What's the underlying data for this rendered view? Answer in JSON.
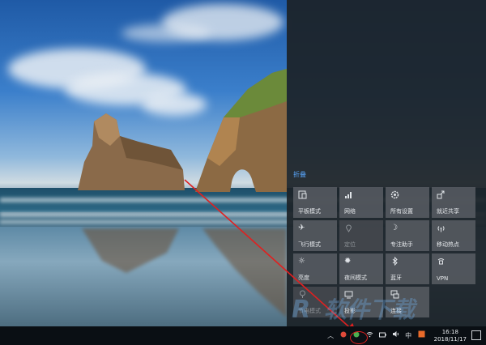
{
  "action_center": {
    "collapse_label": "折叠",
    "tiles": [
      {
        "label": "平板模式",
        "icon": "tablet-mode-icon",
        "state": "on"
      },
      {
        "label": "网络",
        "icon": "network-icon",
        "state": "on"
      },
      {
        "label": "所有设置",
        "icon": "settings-icon",
        "state": "on"
      },
      {
        "label": "就近共享",
        "icon": "nearby-share-icon",
        "state": "on"
      },
      {
        "label": "飞行模式",
        "icon": "airplane-icon",
        "state": "on"
      },
      {
        "label": "定位",
        "icon": "location-icon",
        "state": "off"
      },
      {
        "label": "专注助手",
        "icon": "moon-icon",
        "state": "on"
      },
      {
        "label": "移动热点",
        "icon": "hotspot-icon",
        "state": "on"
      },
      {
        "label": "亮度",
        "icon": "brightness-icon",
        "state": "on"
      },
      {
        "label": "夜间模式",
        "icon": "night-light-icon",
        "state": "on"
      },
      {
        "label": "蓝牙",
        "icon": "bluetooth-icon",
        "state": "on"
      },
      {
        "label": "VPN",
        "icon": "vpn-icon",
        "state": "on"
      },
      {
        "label": "节电模式",
        "icon": "battery-saver-icon",
        "state": "off"
      },
      {
        "label": "投影",
        "icon": "project-icon",
        "state": "on"
      },
      {
        "label": "连接",
        "icon": "connect-icon",
        "state": "on"
      }
    ]
  },
  "taskbar": {
    "time": "16:18",
    "date": "2018/11/17",
    "ime": "中",
    "tray_icons": [
      "chevron-up-icon",
      "app-icon-red",
      "app-icon-green",
      "network-icon",
      "battery-icon",
      "volume-icon"
    ]
  },
  "colors": {
    "accent_link": "#5aa8ff",
    "annotation_red": "#e02020"
  }
}
